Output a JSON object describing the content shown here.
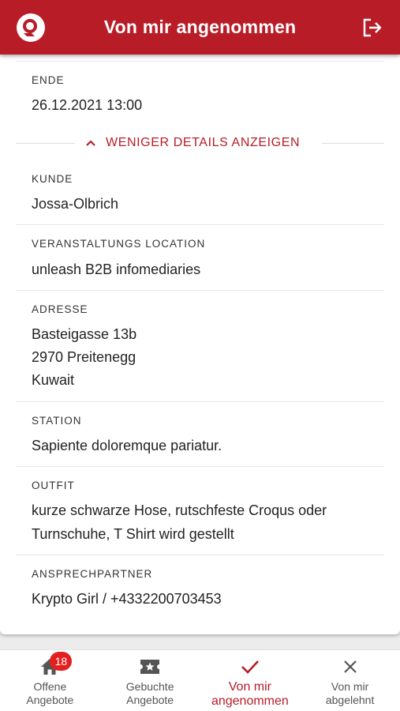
{
  "header": {
    "title": "Von mir angenommen",
    "logo_icon": "brand-logo-icon",
    "logout_icon": "logout-icon"
  },
  "details": {
    "ende": {
      "label": "ENDE",
      "value": "26.12.2021 13:00"
    },
    "toggle_label": "WENIGER DETAILS ANZEIGEN",
    "kunde": {
      "label": "KUNDE",
      "value": "Jossa-Olbrich"
    },
    "location": {
      "label": "VERANSTALTUNGS LOCATION",
      "value": "unleash B2B infomediaries"
    },
    "adresse": {
      "label": "ADRESSE",
      "line1": "Basteigasse 13b",
      "line2": "2970 Preitenegg",
      "line3": "Kuwait"
    },
    "station": {
      "label": "STATION",
      "value": "Sapiente doloremque pariatur."
    },
    "outfit": {
      "label": "OUTFIT",
      "line1": "kurze schwarze Hose, rutschfeste Croqus oder",
      "line2": "Turnschuhe, T Shirt wird gestellt"
    },
    "ansprechpartner": {
      "label": "ANSPRECHPARTNER",
      "value": "Krypto Girl / +4332200703453"
    }
  },
  "nav": {
    "items": [
      {
        "label": "Offene\nAngebote",
        "icon": "home-icon",
        "badge": "18"
      },
      {
        "label": "Gebuchte\nAngebote",
        "icon": "ticket-star-icon"
      },
      {
        "label": "Von mir\nangenommen",
        "icon": "check-icon",
        "active": true
      },
      {
        "label": "Von mir\nabgelehnt",
        "icon": "close-icon"
      }
    ]
  },
  "colors": {
    "primary": "#b81c27",
    "badge": "#e32020",
    "background": "#ececec"
  }
}
